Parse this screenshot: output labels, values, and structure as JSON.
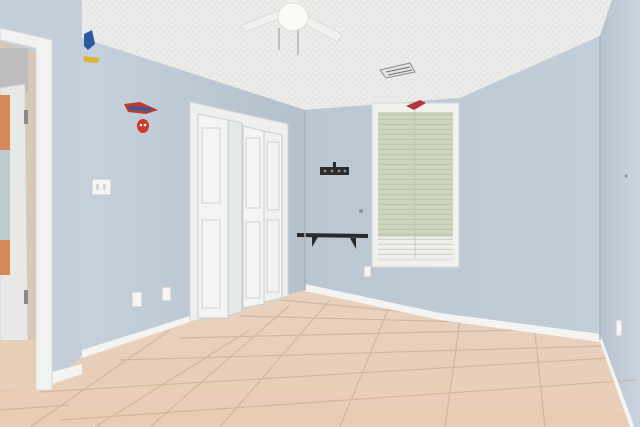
{
  "scene": {
    "description_colors": {
      "wall": "#bfcad6",
      "wall_shadow": "#a9b5c2",
      "ceiling": "#e9e9e7",
      "floor_tile": "#e6cdb8",
      "grout": "#d3b8a2",
      "trim": "#f2f2f0"
    },
    "objects": [
      "ceiling-fan",
      "air-vent",
      "bifold-closet-door",
      "window-with-blinds",
      "wall-shelf",
      "coat-hook-rack",
      "spider-man-wall-decal",
      "open-bedroom-door",
      "tile-floor",
      "light-switch",
      "electrical-outlet"
    ]
  }
}
